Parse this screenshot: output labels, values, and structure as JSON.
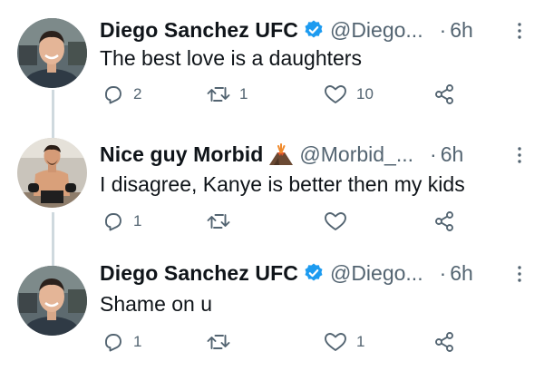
{
  "tweets": [
    {
      "name": "Diego Sanchez UFC",
      "handle": "@Diego...",
      "separator": "·",
      "time": "6h",
      "verified": true,
      "name_icon": "verified-badge-icon",
      "text": "The best love is a daughters",
      "replies": "2",
      "retweets": "1",
      "likes": "10"
    },
    {
      "name": "Nice guy Morbid",
      "handle": "@Morbid_...",
      "separator": "·",
      "time": "6h",
      "verified": false,
      "name_icon": "volcano-emoji-icon",
      "text": "I disagree, Kanye is better then my kids",
      "replies": "1",
      "retweets": "",
      "likes": ""
    },
    {
      "name": "Diego Sanchez UFC",
      "handle": "@Diego...",
      "separator": "·",
      "time": "6h",
      "verified": true,
      "name_icon": "verified-badge-icon",
      "text": "Shame on u",
      "replies": "1",
      "retweets": "",
      "likes": "1"
    }
  ],
  "colors": {
    "verified_blue": "#1d9bf0",
    "muted_text": "#536471",
    "thread_line": "#cfd9de"
  }
}
